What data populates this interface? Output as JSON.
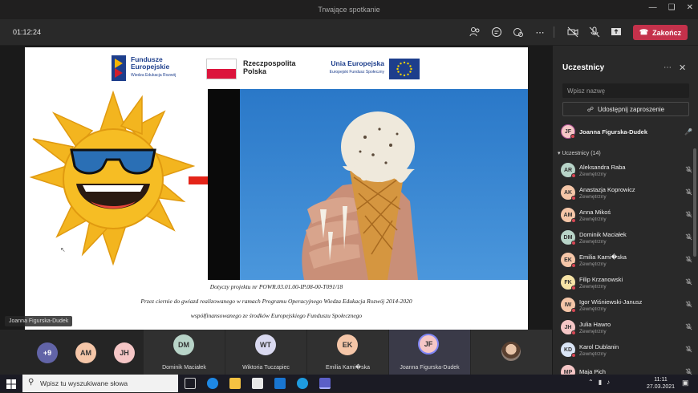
{
  "window": {
    "title": "Trwające spotkanie"
  },
  "toolbar": {
    "timer": "01:12:24",
    "end_label": "Zakończ"
  },
  "slide": {
    "logo1_line1": "Fundusze",
    "logo1_line2": "Europejskie",
    "logo1_line3": "Wiedza Edukacja Rozwój",
    "logo2_line1": "Rzeczpospolita",
    "logo2_line2": "Polska",
    "logo3_line1": "Unia Europejska",
    "logo3_line2": "Europejski Fundusz Społeczny",
    "text1": "Dotyczy projektu nr POWR.03.01.00-IP.08-00-T091/18",
    "text2": "Przez ciernie do gwiazd realizowanego w ramach Programu Operacyjnego Wiedza Edukacja Rozwój 2014-2020",
    "text3": "współfinansowanego ze środków Europejskiego Funduszu Społecznego"
  },
  "presenter_tag": "Joanna Figurska-Dudek",
  "panel": {
    "title": "Uczestnicy",
    "search_placeholder": "Wpisz nazwę",
    "share_label": "Udostępnij zaproszenie",
    "organizer": {
      "initials": "JF",
      "name": "Joanna Figurska-Dudek"
    },
    "section_label": "Uczestnicy (14)",
    "participants": [
      {
        "initials": "AR",
        "name": "Aleksandra Raba",
        "sub": "Zewnętrzny",
        "color": "#b8d4c8"
      },
      {
        "initials": "AK",
        "name": "Anastazja Koprowicz",
        "sub": "Zewnętrzny",
        "color": "#f5c6a8"
      },
      {
        "initials": "AM",
        "name": "Anna Mikoś",
        "sub": "Zewnętrzny",
        "color": "#f5c6a8"
      },
      {
        "initials": "DM",
        "name": "Dominik Maciałek",
        "sub": "Zewnętrzny",
        "color": "#b8d4c8"
      },
      {
        "initials": "EK",
        "name": "Emilia Kami�ska",
        "sub": "Zewnętrzny",
        "color": "#f5c6a8"
      },
      {
        "initials": "FK",
        "name": "Filip Krzanowski",
        "sub": "Zewnętrzny",
        "color": "#f6e3a6"
      },
      {
        "initials": "IW",
        "name": "Igor Wiśniewski-Janusz",
        "sub": "Zewnętrzny",
        "color": "#f5c6a8"
      },
      {
        "initials": "JH",
        "name": "Julia Hawro",
        "sub": "Zewnętrzny",
        "color": "#f5c6c6"
      },
      {
        "initials": "KD",
        "name": "Karol Dublanin",
        "sub": "Zewnętrzny",
        "color": "#d9e4f5"
      },
      {
        "initials": "MP",
        "name": "Maja Pich",
        "sub": "",
        "color": "#f5c6c6"
      }
    ]
  },
  "strip": {
    "more": "+9",
    "am": "AM",
    "jh": "JH",
    "tiles": [
      {
        "initials": "DM",
        "name": "Dominik Maciałek"
      },
      {
        "initials": "WT",
        "name": "Wiktoria Tuczapiec"
      },
      {
        "initials": "EK",
        "name": "Emilia Kami�ska"
      },
      {
        "initials": "JF",
        "name": "Joanna Figurska-Dudek"
      }
    ]
  },
  "taskbar": {
    "search_placeholder": "Wpisz tu wyszukiwane słowa",
    "time": "11:11",
    "date": "27.03.2021"
  }
}
